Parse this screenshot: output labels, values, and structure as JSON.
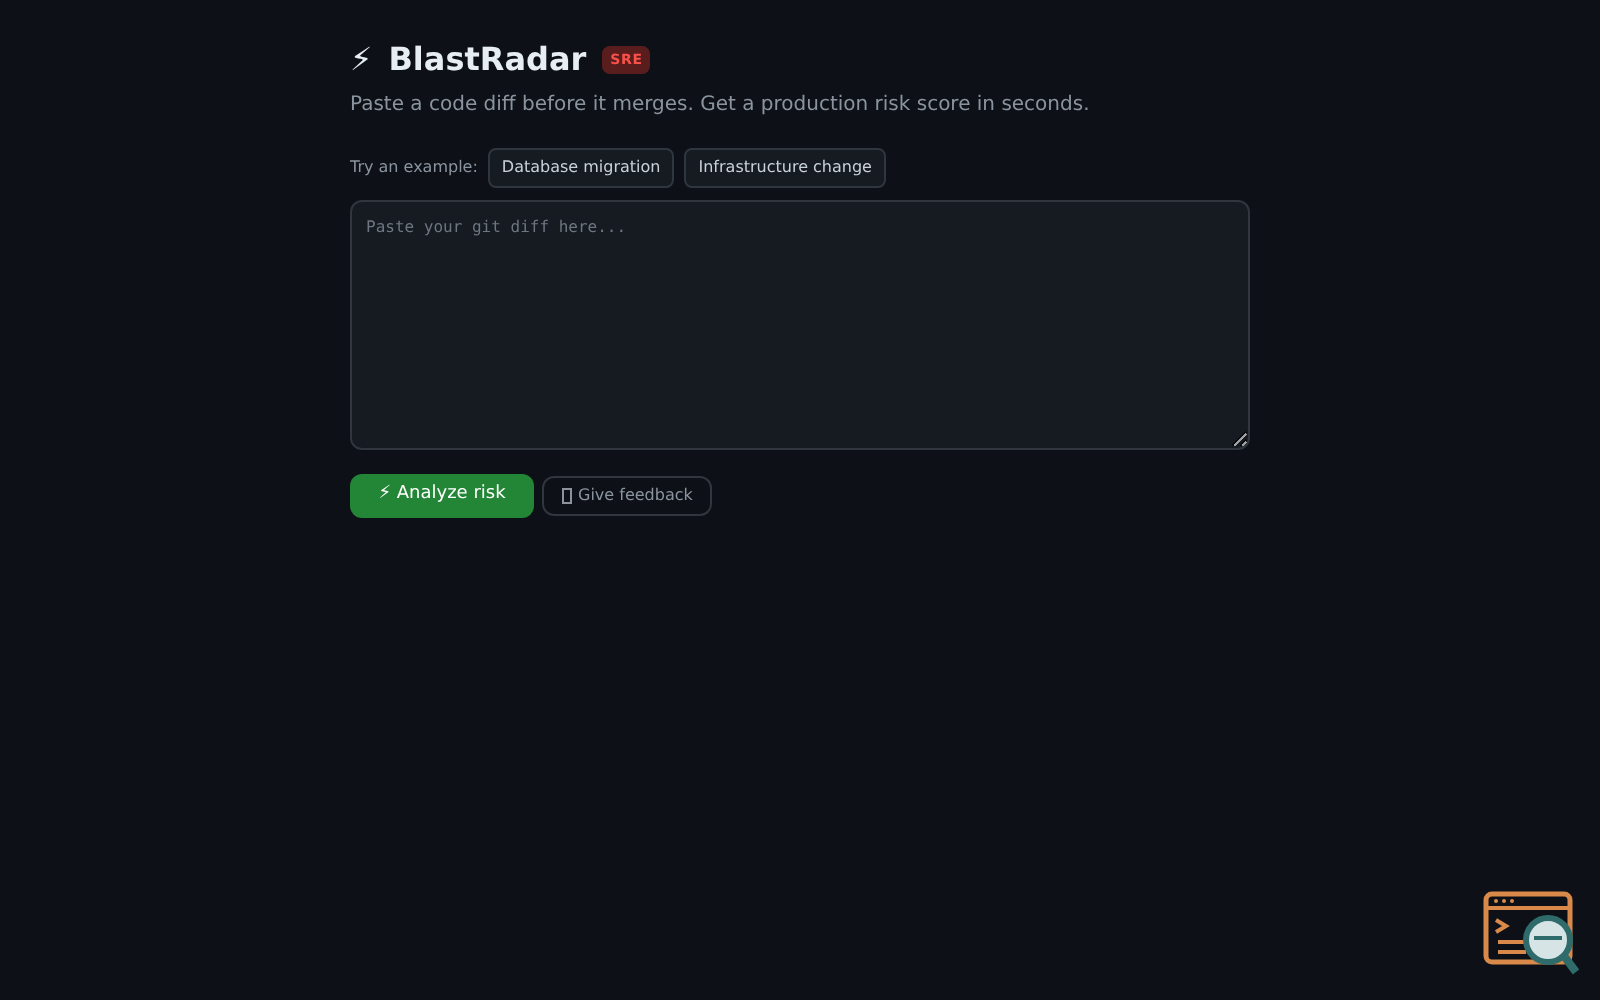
{
  "header": {
    "bolt": "⚡",
    "title": "BlastRadar",
    "badge": "SRE",
    "subtitle": "Paste a code diff before it merges. Get a production risk score in seconds."
  },
  "examples": {
    "label": "Try an example:",
    "items": [
      "Database migration",
      "Infrastructure change"
    ]
  },
  "diff_input": {
    "placeholder": "Paste your git diff here..."
  },
  "actions": {
    "analyze": "⚡ Analyze risk",
    "feedback": "Give feedback"
  }
}
